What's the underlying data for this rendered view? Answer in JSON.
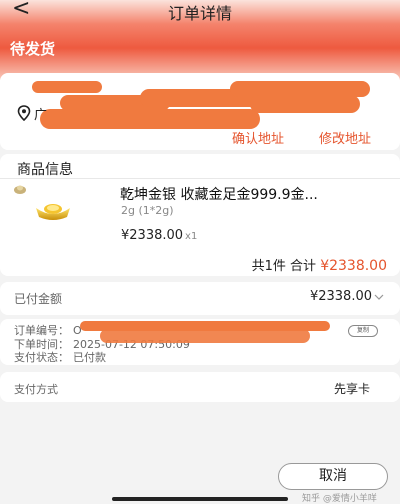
{
  "nav": {
    "back_glyph": "<",
    "title": "订单详情"
  },
  "order_status": "待发货",
  "address": {
    "prefix": "广",
    "confirm_label": "确认地址",
    "modify_label": "修改地址"
  },
  "goods": {
    "section_title": "商品信息",
    "product_name": "乾坤金银 收藏金足金999.9金...",
    "spec": "2g  (1*2g)",
    "unit_price": "¥2338.00",
    "qty": "x1",
    "total_prefix": "共1件 合计",
    "total_amount": "¥2338.00"
  },
  "payment_summary": {
    "label": "已付金额",
    "value": "¥2338.00"
  },
  "order_info": {
    "order_no_label": "订单编号：",
    "order_no_value": "O",
    "order_time_label": "下单时间：",
    "order_time_value": "2025-07-12 07:50:09",
    "pay_status_label": "支付状态：",
    "pay_status_value": "已付款",
    "copy_label": "复制"
  },
  "pay_method": {
    "label": "支付方式",
    "value": "先享卡"
  },
  "bottom": {
    "cancel_label": "取消",
    "watermark": "知乎 @爱情小羊咩"
  },
  "colors": {
    "accent": "#e5542d",
    "header_red": "#ee5a3f",
    "redaction": "#f07a3f"
  },
  "icons": {
    "back": "chevron-left-icon",
    "location": "location-pin-icon",
    "expand": "chevron-down-icon"
  }
}
